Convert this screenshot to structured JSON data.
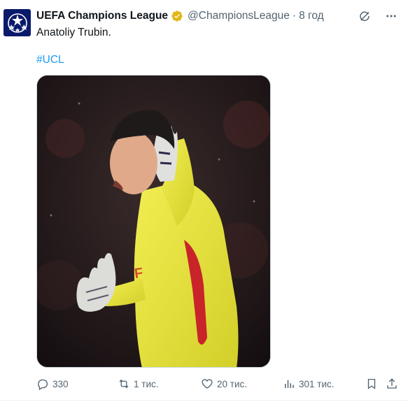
{
  "tweet": {
    "author_name": "UEFA Champions League",
    "handle": "@ChampionsLeague",
    "separator": "·",
    "time": "8 год",
    "text": "Anatoliy Trubin.",
    "hashtag": "#UCL"
  },
  "icons": {
    "avatar": "champions-league-starball-logo",
    "verified": "gold-verified-badge-icon",
    "grok": "grok-icon",
    "more": "more-icon",
    "reply": "reply-icon",
    "retweet": "retweet-icon",
    "like": "heart-icon",
    "views": "views-icon",
    "bookmark": "bookmark-icon",
    "share": "share-icon"
  },
  "stats": {
    "replies": "330",
    "retweets": "1 тис.",
    "likes": "20 тис.",
    "views": "301 тис."
  },
  "colors": {
    "verified_gold": "#e2b719",
    "hashtag_blue": "#1d9bf0",
    "secondary_text": "#536471",
    "avatar_bg": "#0a1a6b",
    "jersey_yellow": "#e8e33a"
  }
}
